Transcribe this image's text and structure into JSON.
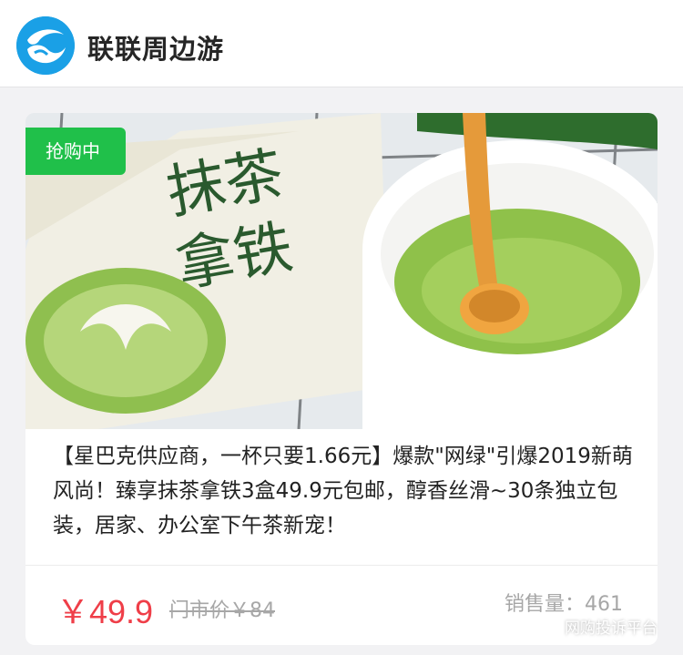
{
  "header": {
    "brand_title": "联联周边游",
    "logo_icon": "wave-swirl-logo",
    "logo_color": "#1aa0e6"
  },
  "product": {
    "badge": "抢购中",
    "badge_color": "#20c04a",
    "image_icon": "matcha-latte-photo",
    "description": "【星巴克供应商，一杯只要1.66元】爆款\"网绿\"引爆2019新萌风尚！臻享抹茶拿铁3盒49.9元包邮，醇香丝滑~30条独立包装，居家、办公室下午茶新宠！",
    "price": "￥49.9",
    "price_color": "#ef3e48",
    "original_price": "门市价￥84",
    "sales": "销售量：461"
  },
  "watermark": {
    "text": "网购投诉平台",
    "icon": "wechat-chat-icon"
  }
}
